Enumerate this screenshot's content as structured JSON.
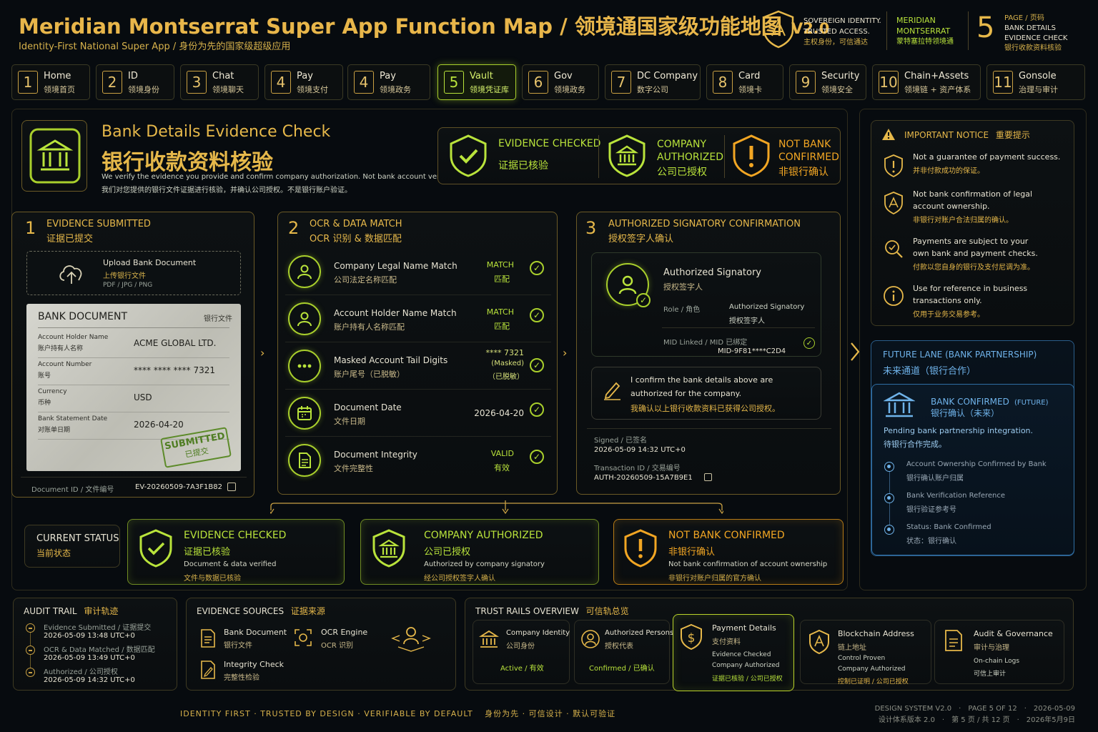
{
  "header": {
    "title": "Meridian Montserrat Super App Function Map / 领境通国家级功能地图",
    "version": "V2.0",
    "subtitle": "Identity-First National Super App / 身份为先的国家级超级应用",
    "sovereign_en_1": "SOVEREIGN IDENTITY.",
    "sovereign_en_2": "TRUSTED ACCESS.",
    "sovereign_cn": "主权身份，可信通达",
    "brand_1": "MERIDIAN",
    "brand_2": "MONTSERRAT",
    "brand_cn": "蒙特塞拉特领境通",
    "page_num": "5",
    "page_label_1": "PAGE / 页码",
    "page_label_2": "BANK DETAILS",
    "page_label_3": "EVIDENCE CHECK",
    "page_label_4": "银行收款资料核验"
  },
  "nav": [
    {
      "num": "1",
      "en": "Home",
      "cn": "领境首页"
    },
    {
      "num": "2",
      "en": "ID",
      "cn": "领境身份"
    },
    {
      "num": "3",
      "en": "Chat",
      "cn": "领境聊天"
    },
    {
      "num": "4",
      "en": "Pay",
      "cn": "领境支付"
    },
    {
      "num": "4",
      "en": "Pay",
      "cn": "领境政务"
    },
    {
      "num": "5",
      "en": "Vault",
      "cn": "领境凭证库"
    },
    {
      "num": "6",
      "en": "Gov",
      "cn": "领境政务"
    },
    {
      "num": "7",
      "en": "DC Company",
      "cn": "数字公司"
    },
    {
      "num": "8",
      "en": "Card",
      "cn": "领境卡"
    },
    {
      "num": "9",
      "en": "Security",
      "cn": "领境安全"
    },
    {
      "num": "10",
      "en": "Chain+Assets",
      "cn": "领境链 + 资产体系"
    },
    {
      "num": "11",
      "en": "Gonsole",
      "cn": "治理与审计"
    }
  ],
  "hero": {
    "title_en": "Bank Details Evidence Check",
    "title_cn": "银行收款资料核验",
    "desc_en": "We verify the evidence you provide and confirm company authorization. Not bank account verification.",
    "desc_cn": "我们对您提供的银行文件证据进行核验，并确认公司授权。不是银行账户验证。",
    "badge_1_en": "EVIDENCE CHECKED",
    "badge_1_cn": "证据已核验",
    "badge_2_en_1": "COMPANY",
    "badge_2_en_2": "AUTHORIZED",
    "badge_2_cn": "公司已授权",
    "badge_3_en_1": "NOT BANK",
    "badge_3_en_2": "CONFIRMED",
    "badge_3_cn": "非银行确认"
  },
  "step1": {
    "num": "1",
    "en": "EVIDENCE SUBMITTED",
    "cn": "证据已提交",
    "upload_en": "Upload Bank Document",
    "upload_cn": "上传银行文件",
    "upload_types": "PDF / JPG / PNG",
    "doc_title": "BANK DOCUMENT",
    "doc_title_cn": "银行文件",
    "rows": [
      {
        "label_en": "Account Holder Name",
        "label_cn": "账户持有人名称",
        "value": "ACME GLOBAL LTD."
      },
      {
        "label_en": "Account Number",
        "label_cn": "账号",
        "value": "**** **** **** 7321"
      },
      {
        "label_en": "Currency",
        "label_cn": "币种",
        "value": "USD"
      },
      {
        "label_en": "Bank Statement Date",
        "label_cn": "对账单日期",
        "value": "2026-04-20"
      }
    ],
    "stamp_en": "SUBMITTED",
    "stamp_cn": "已提交",
    "doc_id_label": "Document ID / 文件编号",
    "doc_id": "EV-20260509-7A3F1B82"
  },
  "step2": {
    "num": "2",
    "en": "OCR & DATA MATCH",
    "cn": "OCR 识别 & 数据匹配",
    "rows": [
      {
        "en": "Company Legal Name Match",
        "cn": "公司法定名称匹配",
        "val1": "MATCH",
        "val2": "匹配",
        "val3": ""
      },
      {
        "en": "Account Holder Name Match",
        "cn": "账户持有人名称匹配",
        "val1": "MATCH",
        "val2": "匹配",
        "val3": ""
      },
      {
        "en": "Masked Account Tail Digits",
        "cn": "账户尾号（已脱敏）",
        "val1": "**** 7321",
        "val2": "(Masked)",
        "val3": "（已脱敏）"
      },
      {
        "en": "Document Date",
        "cn": "文件日期",
        "val1": "2026-04-20",
        "val2": "",
        "val3": ""
      },
      {
        "en": "Document Integrity",
        "cn": "文件完整性",
        "val1": "VALID",
        "val2": "有效",
        "val3": ""
      }
    ]
  },
  "step3": {
    "num": "3",
    "en": "AUTHORIZED SIGNATORY CONFIRMATION",
    "cn": "授权签字人确认",
    "sig_en": "Authorized Signatory",
    "sig_cn": "授权签字人",
    "role_label": "Role / 角色",
    "role_en": "Authorized Signatory",
    "role_cn": "授权签字人",
    "mid_label": "MID Linked / MID 已绑定",
    "mid_value": "MID-9F81****C2D4",
    "confirm_en_1": "I confirm the bank details above are",
    "confirm_en_2": "authorized for the company.",
    "confirm_cn": "我确认以上银行收款资料已获得公司授权。",
    "signed_label": "Signed / 已签名",
    "signed_value": "2026-05-09 14:32 UTC+0",
    "tx_label": "Transaction ID / 交易编号",
    "tx_value": "AUTH-20260509-15A7B9E1"
  },
  "status": {
    "label_en": "CURRENT STATUS",
    "label_cn": "当前状态",
    "cards": [
      {
        "title_en": "EVIDENCE CHECKED",
        "title_cn": "证据已核验",
        "desc_en": "Document & data verified",
        "desc_cn": "文件与数据已核验"
      },
      {
        "title_en": "COMPANY AUTHORIZED",
        "title_cn": "公司已授权",
        "desc_en": "Authorized by company signatory",
        "desc_cn": "经公司授权签字人确认"
      },
      {
        "title_en": "NOT BANK CONFIRMED",
        "title_cn": "非银行确认",
        "desc_en": "Not bank confirmation of account ownership",
        "desc_cn": "非银行对账户归属的官方确认"
      }
    ]
  },
  "notice": {
    "title_en": "IMPORTANT NOTICE",
    "title_cn": "重要提示",
    "items": [
      {
        "en_1": "Not a guarantee of payment success.",
        "en_2": "",
        "cn": "并非付款成功的保证。"
      },
      {
        "en_1": "Not bank confirmation of legal",
        "en_2": "account ownership.",
        "cn": "非银行对账户合法归属的确认。"
      },
      {
        "en_1": "Payments are subject to your",
        "en_2": "own bank and payment checks.",
        "cn": "付款以您自身的银行及支付尼调为准。"
      },
      {
        "en_1": "Use for reference in business",
        "en_2": "transactions only.",
        "cn": "仅用于业务交易参考。"
      }
    ]
  },
  "future": {
    "title_en": "FUTURE LANE (BANK PARTNERSHIP)",
    "title_cn": "未来通道（银行合作）",
    "card_en": "BANK CONFIRMED",
    "card_tag": "(FUTURE)",
    "card_cn": "银行确认（未来）",
    "pending_en": "Pending bank partnership integration.",
    "pending_cn": "待银行合作完成。",
    "items": [
      {
        "en": "Account Ownership Confirmed by Bank",
        "cn": "银行确认账户归属"
      },
      {
        "en": "Bank Verification Reference",
        "cn": "银行验证参考号"
      },
      {
        "en": "Status: Bank Confirmed",
        "cn": "状态：银行确认"
      }
    ]
  },
  "audit": {
    "title_en": "AUDIT TRAIL",
    "title_cn": "审计轨迹",
    "items": [
      {
        "label": "Evidence Submitted / 证据提交",
        "time": "2026-05-09 13:48 UTC+0"
      },
      {
        "label": "OCR & Data Matched / 数据匹配",
        "time": "2026-05-09 13:49 UTC+0"
      },
      {
        "label": "Authorized / 公司授权",
        "time": "2026-05-09 14:32 UTC+0"
      }
    ]
  },
  "sources": {
    "title_en": "EVIDENCE SOURCES",
    "title_cn": "证据来源",
    "items": [
      {
        "en": "Bank Document",
        "cn": "银行文件"
      },
      {
        "en": "OCR Engine",
        "cn": "OCR 识别"
      },
      {
        "en": "Integrity Check",
        "cn": "完整性检验"
      }
    ]
  },
  "rails": {
    "title_en": "TRUST RAILS OVERVIEW",
    "title_cn": "可信轨总览",
    "items": [
      {
        "en": "Company Identity",
        "cn": "公司身份",
        "status": "Active / 有效"
      },
      {
        "en": "Authorized Persons",
        "cn": "授权代表",
        "status": "Confirmed / 已确认"
      }
    ],
    "payment": {
      "en": "Payment Details",
      "cn": "支付资料",
      "s1": "Evidence Checked",
      "s2": "Company Authorized",
      "s3": "证据已核验 / 公司已授权"
    },
    "chain": {
      "en": "Blockchain Address",
      "cn": "链上地址",
      "s1": "Control Proven",
      "s2": "Company Authorized",
      "s3": "控制已证明 / 公司已授权"
    },
    "gov": {
      "en": "Audit & Governance",
      "cn": "审计与治理",
      "s1": "On-chain Logs",
      "s2": "可信上审计"
    }
  },
  "footer": {
    "tagline": "IDENTITY FIRST · TRUSTED BY DESIGN · VERIFIABLE BY DEFAULT　 身份为先 · 可信设计 · 默认可验证",
    "right_1": "DESIGN SYSTEM V2.0　·　PAGE 5 OF 12　·　2026-05-09",
    "right_2": "设计体系版本 2.0　·　第 5 页 / 共 12 页　·　2026年5月9日"
  }
}
